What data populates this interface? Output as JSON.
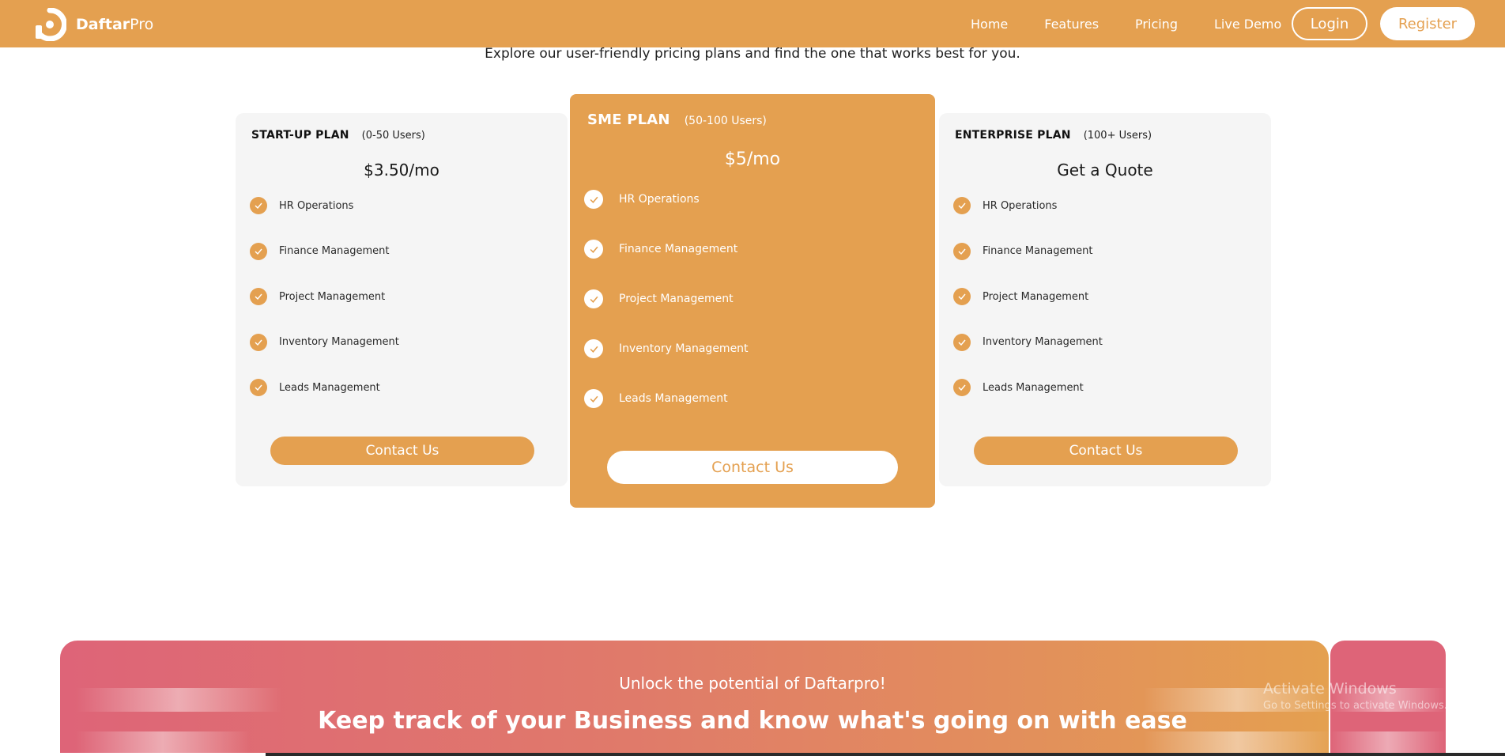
{
  "brand": {
    "name_bold": "Daftar",
    "name_light": "Pro",
    "accent": "#e4a050"
  },
  "nav": {
    "links": [
      "Home",
      "Features",
      "Pricing",
      "Live Demo"
    ],
    "login": "Login",
    "register": "Register"
  },
  "subtitle": "Explore our user-friendly pricing plans and find the one that works best for you.",
  "plans": [
    {
      "name": "START-UP PLAN",
      "users": "(0-50 Users)",
      "price": "$3.50/mo",
      "features": [
        "HR Operations",
        "Finance Management",
        "Project Management",
        "Inventory Management",
        "Leads Management"
      ],
      "cta": "Contact Us"
    },
    {
      "name": "SME PLAN",
      "users": "(50-100 Users)",
      "price": "$5/mo",
      "features": [
        "HR Operations",
        "Finance Management",
        "Project Management",
        "Inventory Management",
        "Leads Management"
      ],
      "cta": "Contact Us"
    },
    {
      "name": "ENTERPRISE PLAN",
      "users": "(100+ Users)",
      "price": "Get a Quote",
      "features": [
        "HR Operations",
        "Finance Management",
        "Project Management",
        "Inventory Management",
        "Leads Management"
      ],
      "cta": "Contact Us"
    }
  ],
  "banner": {
    "kicker": "Unlock the potential of Daftarpro!",
    "title": "Keep track of your Business and know what's going on with ease"
  },
  "watermark": {
    "title": "Activate Windows",
    "subtitle": "Go to Settings to activate Windows."
  }
}
